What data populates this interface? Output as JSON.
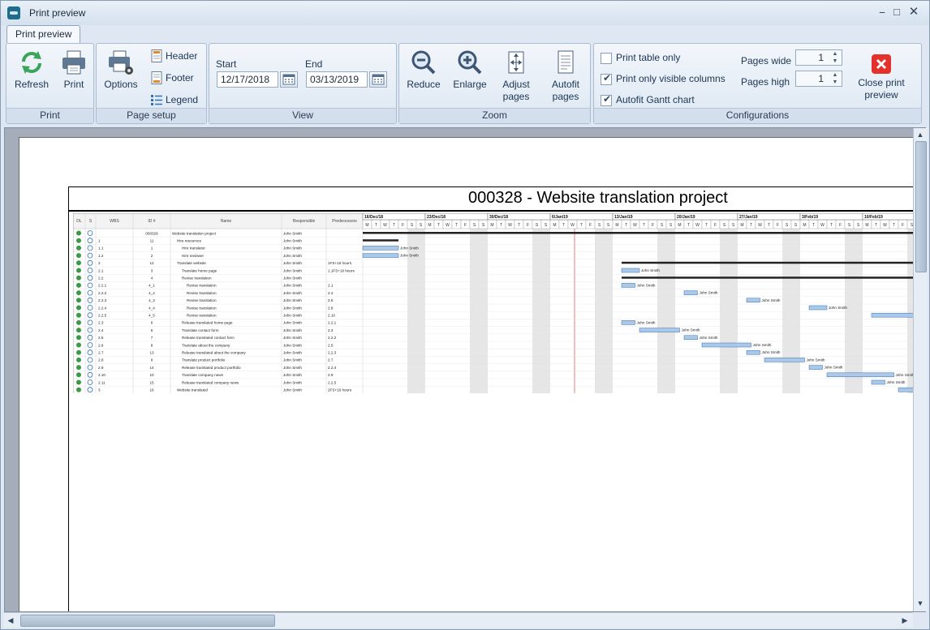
{
  "window": {
    "title": "Print preview"
  },
  "tab": {
    "label": "Print preview"
  },
  "ribbon": {
    "print_group": {
      "label": "Print",
      "refresh": "Refresh",
      "print": "Print"
    },
    "page_setup_group": {
      "label": "Page setup",
      "options": "Options",
      "header": "Header",
      "footer": "Footer",
      "legend": "Legend"
    },
    "view_group": {
      "label": "View",
      "start_label": "Start",
      "start_value": "12/17/2018",
      "end_label": "End",
      "end_value": "03/13/2019"
    },
    "zoom_group": {
      "label": "Zoom",
      "reduce": "Reduce",
      "enlarge": "Enlarge",
      "adjust_1": "Adjust",
      "adjust_2": "pages",
      "autofit_1": "Autofit",
      "autofit_2": "pages"
    },
    "config_group": {
      "label": "Configurations",
      "print_table_only": {
        "label": "Print table only",
        "checked": false
      },
      "print_visible_columns": {
        "label": "Print only visible columns",
        "checked": true
      },
      "autofit_gantt": {
        "label": "Autofit Gantt chart",
        "checked": true
      },
      "pages_wide_label": "Pages wide",
      "pages_wide_value": "1",
      "pages_high_label": "Pages high",
      "pages_high_value": "1",
      "close_1": "Close print",
      "close_2": "preview"
    }
  },
  "document": {
    "title": "000328 - Website translation project",
    "columns": [
      "DL",
      "S",
      "WBS",
      "ID #",
      "Name",
      "Responsible",
      "Predecessors"
    ],
    "weeks": [
      "16/Dec/18",
      "23/Dec/18",
      "30/Dec/18",
      "6/Jan/19",
      "13/Jan/19",
      "20/Jan/19",
      "27/Jan/19",
      "3/Feb/19",
      "10/Feb/19"
    ],
    "day_letters": [
      "M",
      "T",
      "W",
      "T",
      "F",
      "S",
      "S"
    ],
    "rows": [
      {
        "wbs": "",
        "id": "000328",
        "name": "Website translation project",
        "indent": 0,
        "resp": "John Smith",
        "pred": ""
      },
      {
        "wbs": "1",
        "id": "11",
        "name": "Hire resources",
        "indent": 1,
        "resp": "John Smith",
        "pred": ""
      },
      {
        "wbs": "1.1",
        "id": "1",
        "name": "Hire translator",
        "indent": 2,
        "resp": "John Smith",
        "pred": ""
      },
      {
        "wbs": "1.2",
        "id": "2",
        "name": "Hire reviewer",
        "indent": 2,
        "resp": "John Smith",
        "pred": ""
      },
      {
        "wbs": "2",
        "id": "12",
        "name": "Translate website",
        "indent": 1,
        "resp": "John Smith",
        "pred": "1FS+16 hours"
      },
      {
        "wbs": "2.1",
        "id": "3",
        "name": "Translate home page",
        "indent": 2,
        "resp": "John Smith",
        "pred": "1.1FS+16 hours"
      },
      {
        "wbs": "2.2",
        "id": "4",
        "name": "Revise translation",
        "indent": 2,
        "resp": "John Smith",
        "pred": ""
      },
      {
        "wbs": "2.2.1",
        "id": "4_1",
        "name": "Revise translation",
        "indent": 3,
        "resp": "John Smith",
        "pred": "2.1"
      },
      {
        "wbs": "2.2.2",
        "id": "4_2",
        "name": "Revise translation",
        "indent": 3,
        "resp": "John Smith",
        "pred": "2.4"
      },
      {
        "wbs": "2.2.3",
        "id": "4_3",
        "name": "Revise translation",
        "indent": 3,
        "resp": "John Smith",
        "pred": "2.6"
      },
      {
        "wbs": "2.2.4",
        "id": "4_4",
        "name": "Revise translation",
        "indent": 3,
        "resp": "John Smith",
        "pred": "2.8"
      },
      {
        "wbs": "2.2.5",
        "id": "4_5",
        "name": "Revise translation",
        "indent": 3,
        "resp": "John Smith",
        "pred": "2.10"
      },
      {
        "wbs": "2.3",
        "id": "6",
        "name": "Release translated home page",
        "indent": 2,
        "resp": "John Smith",
        "pred": "2.2.1"
      },
      {
        "wbs": "2.4",
        "id": "5",
        "name": "Translate contact form",
        "indent": 2,
        "resp": "John Smith",
        "pred": "2.3"
      },
      {
        "wbs": "2.5",
        "id": "7",
        "name": "Release translated contact form",
        "indent": 2,
        "resp": "John Smith",
        "pred": "2.2.2"
      },
      {
        "wbs": "2.6",
        "id": "8",
        "name": "Translate about the company",
        "indent": 2,
        "resp": "John Smith",
        "pred": "2.5"
      },
      {
        "wbs": "2.7",
        "id": "13",
        "name": "Release translated about the company",
        "indent": 2,
        "resp": "John Smith",
        "pred": "2.2.3"
      },
      {
        "wbs": "2.8",
        "id": "9",
        "name": "Translate product portfolio",
        "indent": 2,
        "resp": "John Smith",
        "pred": "2.7"
      },
      {
        "wbs": "2.9",
        "id": "14",
        "name": "Release translated product portfolio",
        "indent": 2,
        "resp": "John Smith",
        "pred": "2.2.4"
      },
      {
        "wbs": "2.10",
        "id": "10",
        "name": "Translate company news",
        "indent": 2,
        "resp": "John Smith",
        "pred": "2.9"
      },
      {
        "wbs": "2.11",
        "id": "15",
        "name": "Release translated company news",
        "indent": 2,
        "resp": "John Smith",
        "pred": "2.2.5"
      },
      {
        "wbs": "3",
        "id": "16",
        "name": "Website translated",
        "indent": 1,
        "resp": "John Smith",
        "pred": "2FS+16 hours"
      }
    ],
    "bar_label": "John Smith"
  }
}
